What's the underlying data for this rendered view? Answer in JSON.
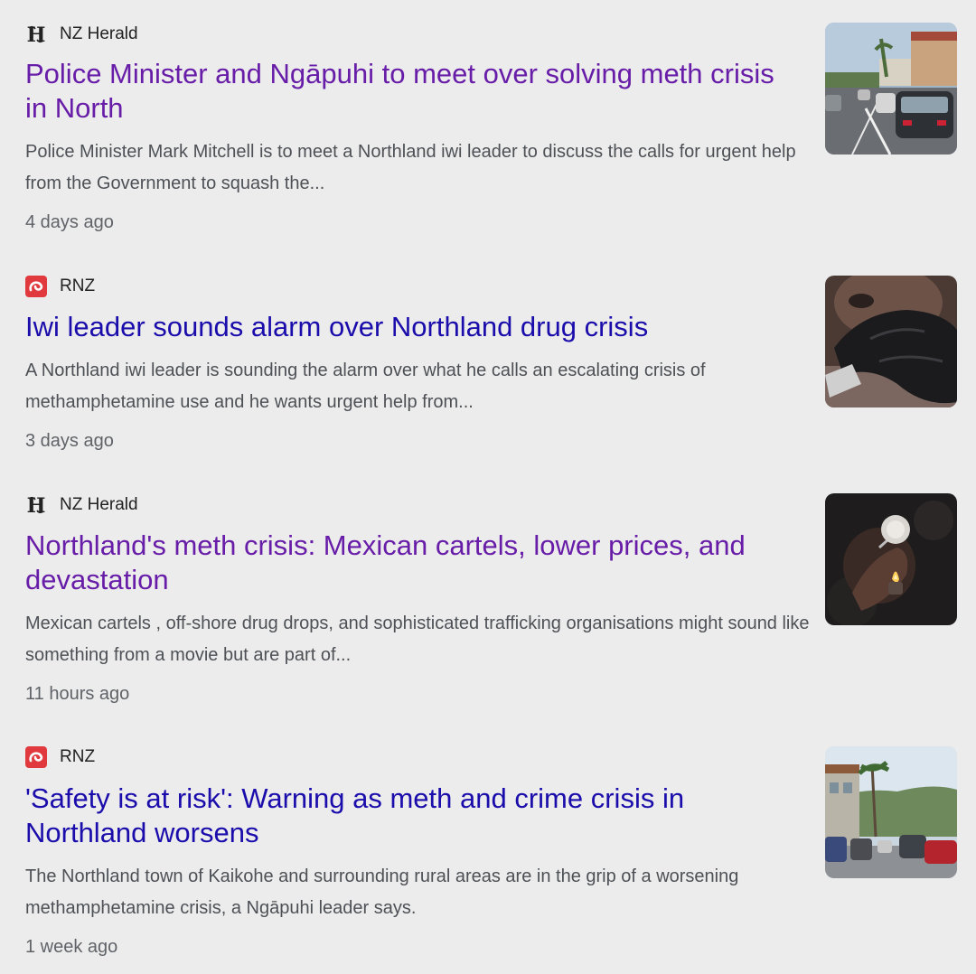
{
  "articles": [
    {
      "source": "NZ Herald",
      "source_icon": "nz-herald-logo-icon",
      "headline": "Police Minister and Ngāpuhi to meet over solving meth crisis in North",
      "snippet": "Police Minister Mark Mitchell is to meet a Northland iwi leader to discuss the calls for urgent help from the Government to squash the...",
      "age": "4 days ago",
      "headline_color": "#681da8",
      "thumbnail": "street-traffic-photo"
    },
    {
      "source": "RNZ",
      "source_icon": "rnz-logo-icon",
      "headline": "Iwi leader sounds alarm over Northland drug crisis",
      "snippet": "A Northland iwi leader is sounding the alarm over what he calls an escalating crisis of methamphetamine use and he wants urgent help from...",
      "age": "3 days ago",
      "headline_color": "#1a0dab",
      "thumbnail": "gloved-hand-photo"
    },
    {
      "source": "NZ Herald",
      "source_icon": "nz-herald-logo-icon",
      "headline": "Northland's meth crisis: Mexican cartels, lower prices, and devastation",
      "snippet": "Mexican cartels , off-shore drug drops, and sophisticated trafficking organisations might sound like something from a movie but are part of...",
      "age": "11 hours ago",
      "headline_color": "#681da8",
      "thumbnail": "lighter-pipe-photo"
    },
    {
      "source": "RNZ",
      "source_icon": "rnz-logo-icon",
      "headline": "'Safety is at risk': Warning as meth and crime crisis in Northland worsens",
      "snippet": "The Northland town of Kaikohe and surrounding rural areas are in the grip of a worsening methamphetamine crisis, a Ngāpuhi leader says.",
      "age": "1 week ago",
      "headline_color": "#1a0dab",
      "thumbnail": "town-street-photo"
    }
  ]
}
